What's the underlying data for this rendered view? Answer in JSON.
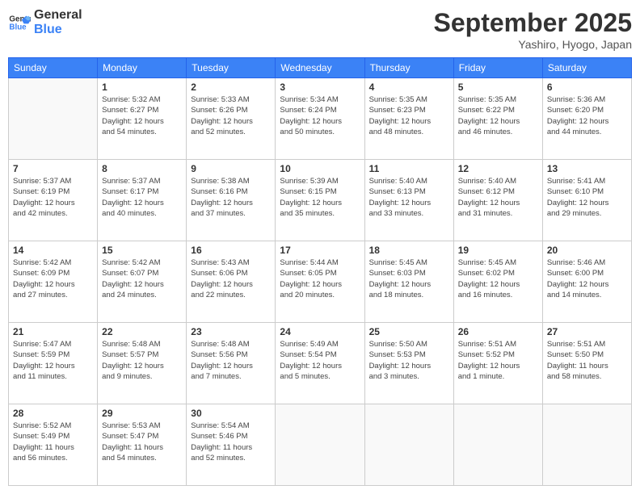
{
  "logo": {
    "line1": "General",
    "line2": "Blue"
  },
  "title": "September 2025",
  "location": "Yashiro, Hyogo, Japan",
  "days": [
    "Sunday",
    "Monday",
    "Tuesday",
    "Wednesday",
    "Thursday",
    "Friday",
    "Saturday"
  ],
  "weeks": [
    [
      {
        "num": "",
        "info": ""
      },
      {
        "num": "1",
        "info": "Sunrise: 5:32 AM\nSunset: 6:27 PM\nDaylight: 12 hours\nand 54 minutes."
      },
      {
        "num": "2",
        "info": "Sunrise: 5:33 AM\nSunset: 6:26 PM\nDaylight: 12 hours\nand 52 minutes."
      },
      {
        "num": "3",
        "info": "Sunrise: 5:34 AM\nSunset: 6:24 PM\nDaylight: 12 hours\nand 50 minutes."
      },
      {
        "num": "4",
        "info": "Sunrise: 5:35 AM\nSunset: 6:23 PM\nDaylight: 12 hours\nand 48 minutes."
      },
      {
        "num": "5",
        "info": "Sunrise: 5:35 AM\nSunset: 6:22 PM\nDaylight: 12 hours\nand 46 minutes."
      },
      {
        "num": "6",
        "info": "Sunrise: 5:36 AM\nSunset: 6:20 PM\nDaylight: 12 hours\nand 44 minutes."
      }
    ],
    [
      {
        "num": "7",
        "info": "Sunrise: 5:37 AM\nSunset: 6:19 PM\nDaylight: 12 hours\nand 42 minutes."
      },
      {
        "num": "8",
        "info": "Sunrise: 5:37 AM\nSunset: 6:17 PM\nDaylight: 12 hours\nand 40 minutes."
      },
      {
        "num": "9",
        "info": "Sunrise: 5:38 AM\nSunset: 6:16 PM\nDaylight: 12 hours\nand 37 minutes."
      },
      {
        "num": "10",
        "info": "Sunrise: 5:39 AM\nSunset: 6:15 PM\nDaylight: 12 hours\nand 35 minutes."
      },
      {
        "num": "11",
        "info": "Sunrise: 5:40 AM\nSunset: 6:13 PM\nDaylight: 12 hours\nand 33 minutes."
      },
      {
        "num": "12",
        "info": "Sunrise: 5:40 AM\nSunset: 6:12 PM\nDaylight: 12 hours\nand 31 minutes."
      },
      {
        "num": "13",
        "info": "Sunrise: 5:41 AM\nSunset: 6:10 PM\nDaylight: 12 hours\nand 29 minutes."
      }
    ],
    [
      {
        "num": "14",
        "info": "Sunrise: 5:42 AM\nSunset: 6:09 PM\nDaylight: 12 hours\nand 27 minutes."
      },
      {
        "num": "15",
        "info": "Sunrise: 5:42 AM\nSunset: 6:07 PM\nDaylight: 12 hours\nand 24 minutes."
      },
      {
        "num": "16",
        "info": "Sunrise: 5:43 AM\nSunset: 6:06 PM\nDaylight: 12 hours\nand 22 minutes."
      },
      {
        "num": "17",
        "info": "Sunrise: 5:44 AM\nSunset: 6:05 PM\nDaylight: 12 hours\nand 20 minutes."
      },
      {
        "num": "18",
        "info": "Sunrise: 5:45 AM\nSunset: 6:03 PM\nDaylight: 12 hours\nand 18 minutes."
      },
      {
        "num": "19",
        "info": "Sunrise: 5:45 AM\nSunset: 6:02 PM\nDaylight: 12 hours\nand 16 minutes."
      },
      {
        "num": "20",
        "info": "Sunrise: 5:46 AM\nSunset: 6:00 PM\nDaylight: 12 hours\nand 14 minutes."
      }
    ],
    [
      {
        "num": "21",
        "info": "Sunrise: 5:47 AM\nSunset: 5:59 PM\nDaylight: 12 hours\nand 11 minutes."
      },
      {
        "num": "22",
        "info": "Sunrise: 5:48 AM\nSunset: 5:57 PM\nDaylight: 12 hours\nand 9 minutes."
      },
      {
        "num": "23",
        "info": "Sunrise: 5:48 AM\nSunset: 5:56 PM\nDaylight: 12 hours\nand 7 minutes."
      },
      {
        "num": "24",
        "info": "Sunrise: 5:49 AM\nSunset: 5:54 PM\nDaylight: 12 hours\nand 5 minutes."
      },
      {
        "num": "25",
        "info": "Sunrise: 5:50 AM\nSunset: 5:53 PM\nDaylight: 12 hours\nand 3 minutes."
      },
      {
        "num": "26",
        "info": "Sunrise: 5:51 AM\nSunset: 5:52 PM\nDaylight: 12 hours\nand 1 minute."
      },
      {
        "num": "27",
        "info": "Sunrise: 5:51 AM\nSunset: 5:50 PM\nDaylight: 11 hours\nand 58 minutes."
      }
    ],
    [
      {
        "num": "28",
        "info": "Sunrise: 5:52 AM\nSunset: 5:49 PM\nDaylight: 11 hours\nand 56 minutes."
      },
      {
        "num": "29",
        "info": "Sunrise: 5:53 AM\nSunset: 5:47 PM\nDaylight: 11 hours\nand 54 minutes."
      },
      {
        "num": "30",
        "info": "Sunrise: 5:54 AM\nSunset: 5:46 PM\nDaylight: 11 hours\nand 52 minutes."
      },
      {
        "num": "",
        "info": ""
      },
      {
        "num": "",
        "info": ""
      },
      {
        "num": "",
        "info": ""
      },
      {
        "num": "",
        "info": ""
      }
    ]
  ]
}
